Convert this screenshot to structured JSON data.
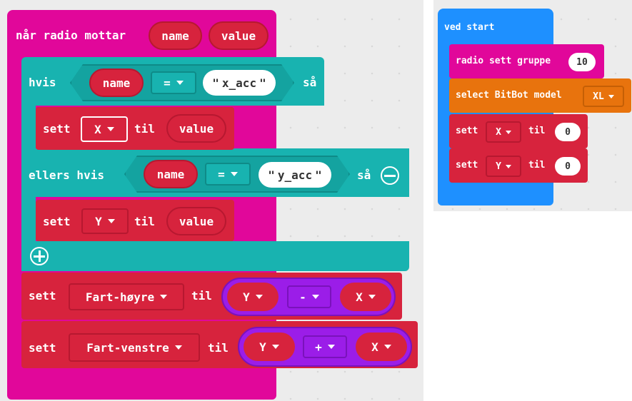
{
  "colors": {
    "events_magenta": "#e1079a",
    "logic_teal": "#18b3b0",
    "variables_red": "#d7233d",
    "math_purple": "#9b1de8",
    "basic_blue": "#1e90ff",
    "bitbot_orange": "#e8730d"
  },
  "radio_handler": {
    "header_label": "når radio mottar",
    "param_name": "name",
    "param_value": "value",
    "if_label": "hvis",
    "if_left": "name",
    "if_op": "=",
    "if_string": "x_acc",
    "then_label": "så",
    "set1": {
      "sett": "sett",
      "var": "X",
      "til": "til",
      "value": "value"
    },
    "elseif_label": "ellers hvis",
    "elseif_left": "name",
    "elseif_op": "=",
    "elseif_string": "y_acc",
    "elseif_then": "så",
    "set2": {
      "sett": "sett",
      "var": "Y",
      "til": "til",
      "value": "value"
    },
    "set3": {
      "sett": "sett",
      "var": "Fart-høyre",
      "til": "til",
      "left": "Y",
      "op": "-",
      "right": "X"
    },
    "set4": {
      "sett": "sett",
      "var": "Fart-venstre",
      "til": "til",
      "left": "Y",
      "op": "+",
      "right": "X"
    }
  },
  "on_start": {
    "header_label": "ved start",
    "radio_label": "radio sett gruppe",
    "radio_value": "10",
    "bitbot_label": "select BitBot model",
    "bitbot_value": "XL",
    "setx": {
      "sett": "sett",
      "var": "X",
      "til": "til",
      "value": "0"
    },
    "sety": {
      "sett": "sett",
      "var": "Y",
      "til": "til",
      "value": "0"
    }
  }
}
